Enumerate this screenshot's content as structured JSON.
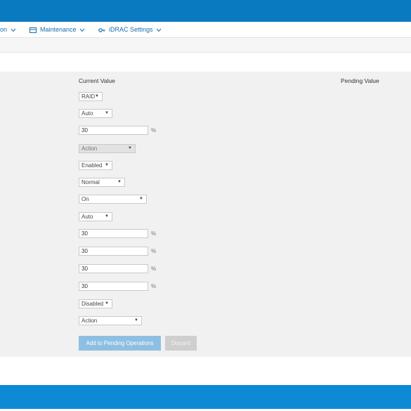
{
  "nav": {
    "partial_label": "on",
    "maintenance_label": "Maintenance",
    "idrac_label": "iDRAC Settings"
  },
  "table": {
    "current_header": "Current Value",
    "pending_header": "Pending Value"
  },
  "fields": {
    "mode_select": "RAID",
    "auto_select_1": "Auto",
    "percent_input_1": "30",
    "action_select_disabled": "Action",
    "enabled_select": "Enabled",
    "normal_select": "Normal",
    "on_select": "On",
    "auto_select_2": "Auto",
    "percent_input_2": "30",
    "percent_input_3": "30",
    "percent_input_4": "30",
    "percent_input_5": "30",
    "disabled_select": "Disabled",
    "action_select": "Action",
    "unit": "%"
  },
  "buttons": {
    "add_pending": "Add to Pending Operations",
    "discard": "Discard"
  },
  "colors": {
    "header_blue": "#0a7ac0",
    "footer_blue": "#0d8ad6",
    "link_blue": "#1a6fa8"
  }
}
